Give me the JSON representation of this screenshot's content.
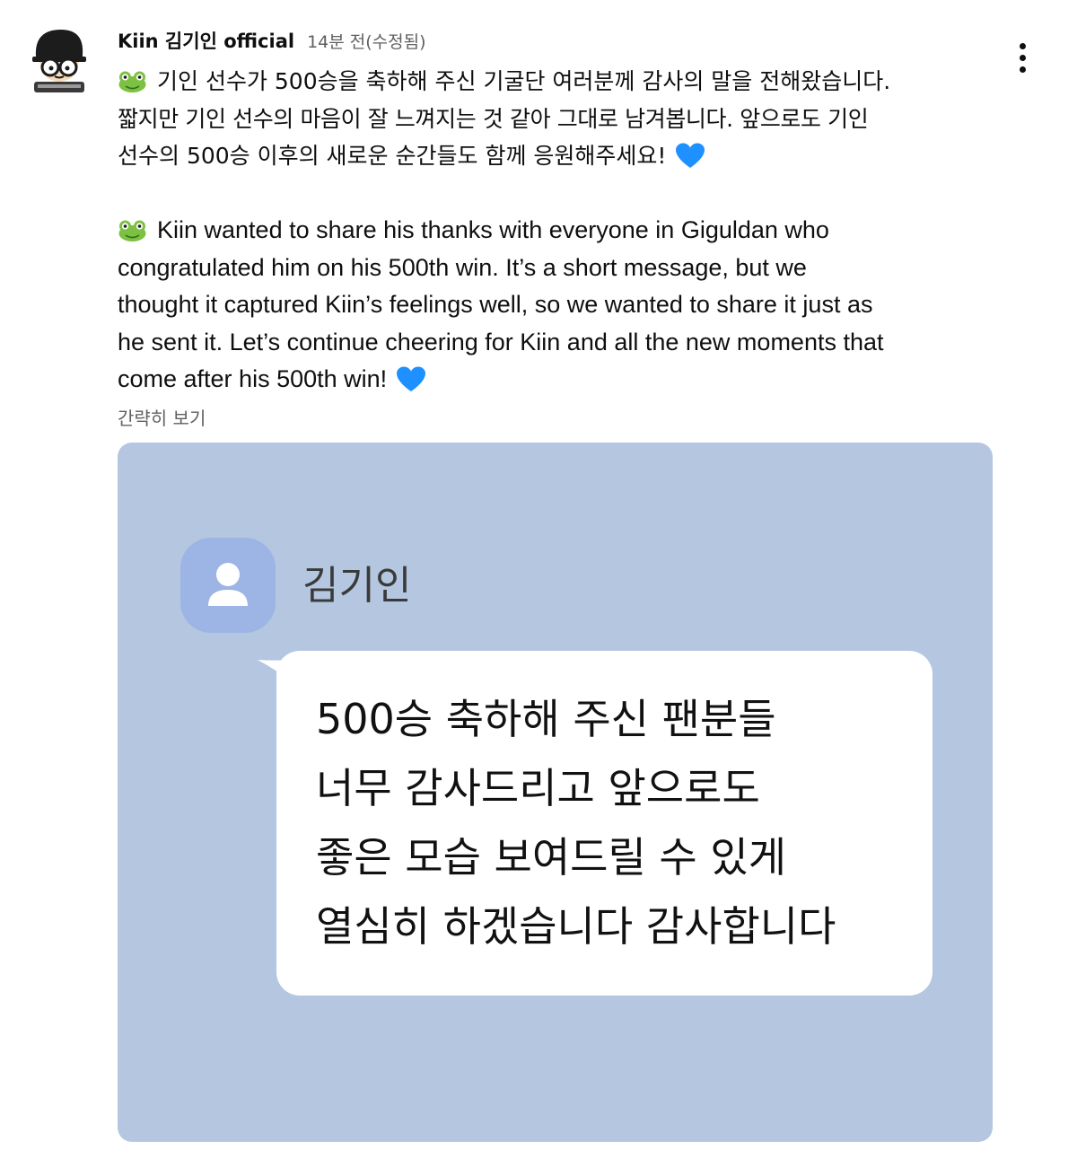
{
  "comment": {
    "author": "Kiin 김기인 official",
    "timestamp": "14분 전(수정됨)",
    "menu_icon": "more-vert-icon",
    "body": {
      "korean_lines": [
        "기인 선수가 500승을 축하해 주신 기굴단 여러분께 감사의 말을 전해왔습니다.",
        "짧지만 기인 선수의 마음이 잘 느껴지는 것 같아 그대로 남겨봅니다. 앞으로도 기인",
        "선수의 500승 이후의 새로운 순간들도 함께 응원해주세요!"
      ],
      "english_lines": [
        "Kiin wanted to share his thanks with everyone in Giguldan who",
        "congratulated him on his 500th win. It’s a short message, but we",
        "thought it captured Kiin’s feelings well, so we wanted to share it just as",
        "he sent it. Let’s continue cheering for Kiin and all the new moments that",
        "come after his 500th win!"
      ],
      "emoji": {
        "frog": "frog-emoji-icon",
        "heart": "blue-heart-emoji-icon"
      }
    },
    "show_less_label": "간략히 보기"
  },
  "attached_image": {
    "contact_name": "김기인",
    "contact_icon": "person-icon",
    "message_lines": [
      "500승 축하해 주신 팬분들",
      "너무 감사드리고 앞으로도",
      "좋은 모습 보여드릴 수 있게",
      "열심히 하겠습니다 감사합니다"
    ]
  },
  "colors": {
    "image_background": "#b4c6e0",
    "contact_avatar": "#9db5e4",
    "heart": "#1e90ff",
    "frog": "#7cc142",
    "secondary_text": "#606060"
  }
}
